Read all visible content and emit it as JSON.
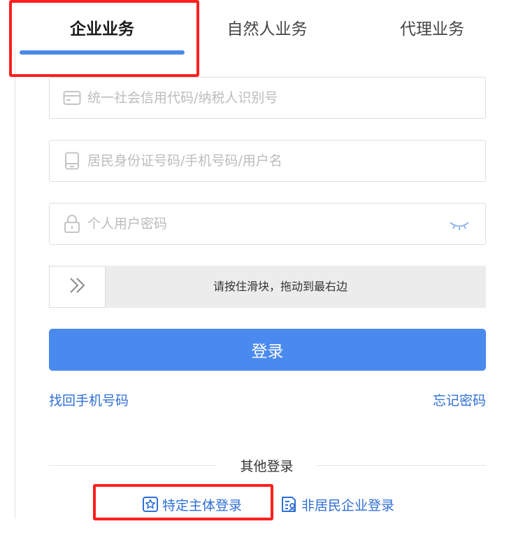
{
  "tabs": [
    {
      "label": "企业业务",
      "active": true
    },
    {
      "label": "自然人业务",
      "active": false
    },
    {
      "label": "代理业务",
      "active": false
    }
  ],
  "form": {
    "credit_code_placeholder": "统一社会信用代码/纳税人识别号",
    "id_phone_user_placeholder": "居民身份证号码/手机号码/用户名",
    "password_placeholder": "个人用户密码",
    "slider_hint": "请按住滑块，拖动到最右边",
    "login_label": "登录"
  },
  "links": {
    "recover_phone": "找回手机号码",
    "forgot_password": "忘记密码"
  },
  "other_login": {
    "title": "其他登录",
    "options": [
      {
        "label": "特定主体登录",
        "icon": "star-badge-icon"
      },
      {
        "label": "非居民企业登录",
        "icon": "id-card-icon"
      }
    ]
  },
  "colors": {
    "accent": "#4a8aee",
    "link": "#2f6fd6",
    "highlight": "#ff1f1f"
  }
}
